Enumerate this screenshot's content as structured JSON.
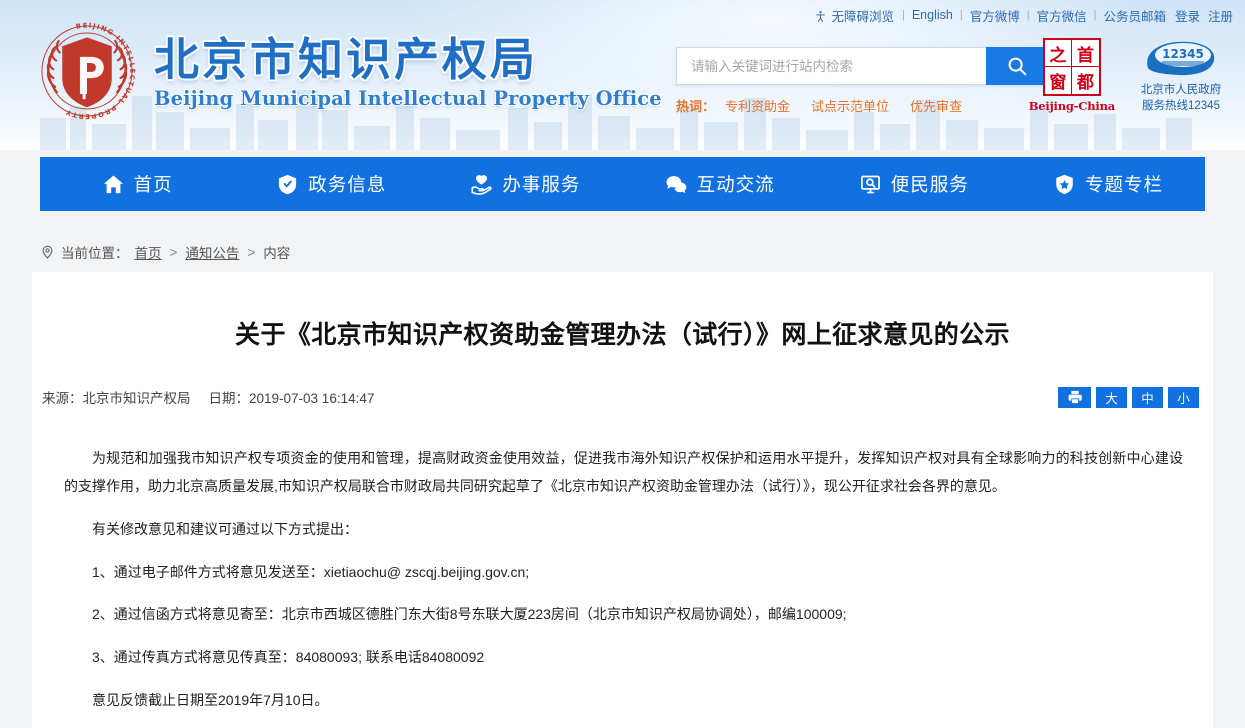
{
  "top_links": {
    "accessibility": "无障碍浏览",
    "english": "English",
    "weibo": "官方微博",
    "wechat": "官方微信",
    "mail": "公务员邮箱",
    "login": "登录",
    "register": "注册"
  },
  "brand": {
    "cn": "北京市知识产权局",
    "en": "Beijing Municipal Intellectual Property Office",
    "emblem_text_outer": "BEIJING INTELLECTUAL PROPERTY",
    "emblem_letter": "P"
  },
  "search": {
    "placeholder": "请输入关键词进行站内检索",
    "value": "",
    "button_icon": "search-icon",
    "hot_label": "热词：",
    "hot_words": [
      "专利资助金",
      "试点示范单位",
      "优先审查"
    ]
  },
  "badges": {
    "seal_chars": [
      "之",
      "首",
      "窗",
      "都"
    ],
    "seal_en": "Beijing-China",
    "hotline_number": "12345",
    "hotline_line1": "北京市人民政府",
    "hotline_line2": "服务热线12345"
  },
  "nav": {
    "items": [
      {
        "label": "首页",
        "icon": "home-icon"
      },
      {
        "label": "政务信息",
        "icon": "shield-icon"
      },
      {
        "label": "办事服务",
        "icon": "service-hand-icon"
      },
      {
        "label": "互动交流",
        "icon": "chat-bubbles-icon"
      },
      {
        "label": "便民服务",
        "icon": "monitor-search-icon"
      },
      {
        "label": "专题专栏",
        "icon": "shield-star-icon"
      }
    ]
  },
  "breadcrumb": {
    "icon": "location-pin-icon",
    "label": "当前位置：",
    "items": [
      "首页",
      "通知公告",
      "内容"
    ],
    "separator": ">"
  },
  "article": {
    "title": "关于《北京市知识产权资助金管理办法（试行）》网上征求意见的公示",
    "source_label": "来源：",
    "source": "北京市知识产权局",
    "date_label": "日期：",
    "date": "2019-07-03 16:14:47",
    "tools": [
      {
        "name": "print",
        "label": "",
        "icon": "printer-icon"
      },
      {
        "name": "font-large",
        "label": "大",
        "icon": ""
      },
      {
        "name": "font-medium",
        "label": "中",
        "icon": ""
      },
      {
        "name": "font-small",
        "label": "小",
        "icon": ""
      }
    ],
    "paragraphs": [
      "为规范和加强我市知识产权专项资金的使用和管理，提高财政资金使用效益，促进我市海外知识产权保护和运用水平提升，发挥知识产权对具有全球影响力的科技创新中心建设的支撑作用，助力北京高质量发展,市知识产权局联合市财政局共同研究起草了《北京市知识产权资助金管理办法（试行）》，现公开征求社会各界的意见。",
      "有关修改意见和建议可通过以下方式提出：",
      "1、通过电子邮件方式将意见发送至：xietiaochu@ zscqj.beijing.gov.cn;",
      "2、通过信函方式将意见寄至：北京市西城区德胜门东大街8号东联大厦223房间（北京市知识产权局协调处），邮编100009;",
      "3、通过传真方式将意见传真至：84080093; 联系电话84080092",
      "意见反馈截止日期至2019年7月10日。"
    ]
  },
  "colors": {
    "primary_blue": "#1271e0",
    "brand_blue": "#1f6fc4",
    "seal_red": "#d0021b",
    "hot_orange": "#e8732a",
    "page_bg": "#f2f3f5"
  }
}
